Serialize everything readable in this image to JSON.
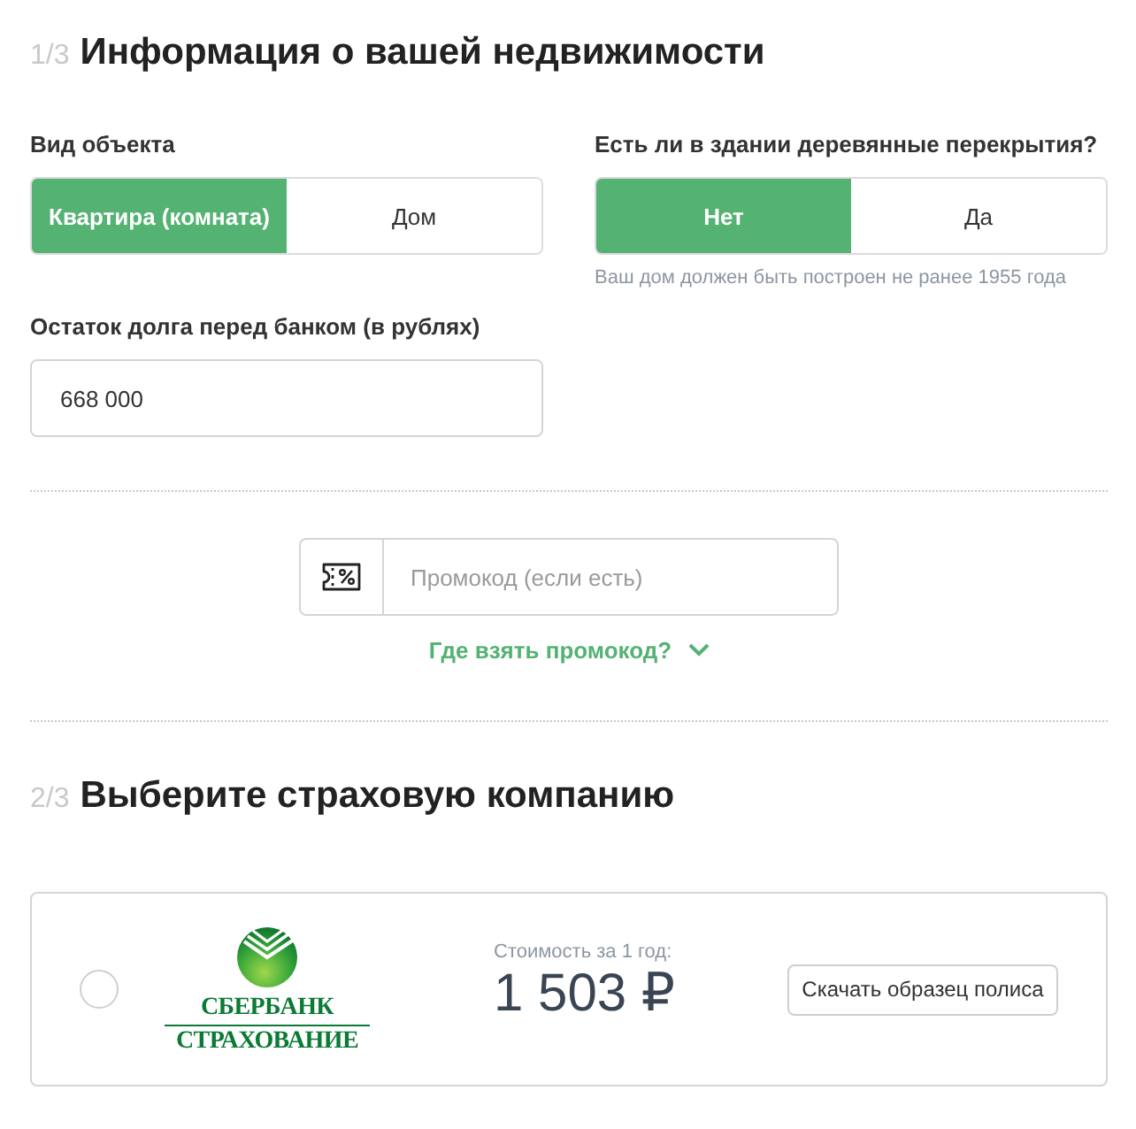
{
  "property_section": {
    "step": "1/3",
    "title": "Информация о вашей недвижимости",
    "object_type": {
      "label": "Вид объекта",
      "options": [
        {
          "label": "Квартира (комната)",
          "selected": true
        },
        {
          "label": "Дом",
          "selected": false
        }
      ]
    },
    "wooden_floors": {
      "label": "Есть ли в здании деревянные перекрытия?",
      "options": [
        {
          "label": "Нет",
          "selected": true
        },
        {
          "label": "Да",
          "selected": false
        }
      ],
      "hint": "Ваш дом должен быть построен не ранее 1955 года"
    },
    "debt": {
      "label": "Остаток долга перед банком (в рублях)",
      "value": "668 000"
    },
    "promo": {
      "placeholder": "Промокод (если есть)",
      "help_link": "Где взять промокод?",
      "help_expanded": false
    }
  },
  "insurer_section": {
    "step": "2/3",
    "title": "Выберите страховую компанию",
    "companies": [
      {
        "selected": false,
        "logo_lines": [
          "СБЕРБАНК",
          "СТРАХОВАНИЕ"
        ],
        "price_label": "Стоимость за 1 год:",
        "price": "1 503 ₽",
        "sample_button": "Скачать образец полиса"
      }
    ]
  }
}
